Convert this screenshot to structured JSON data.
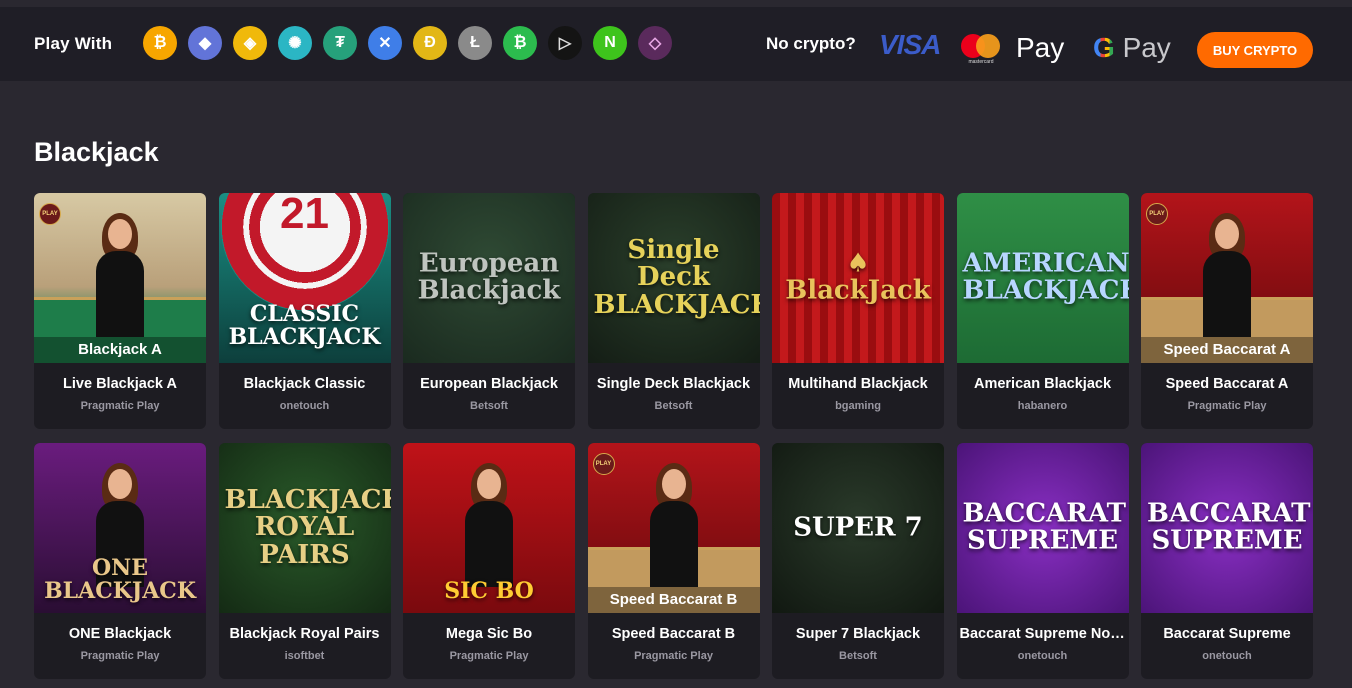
{
  "topbar": {
    "play_with_label": "Play With",
    "coins": [
      {
        "name": "bitcoin-icon",
        "glyph": "₿",
        "color": "#f7a600",
        "fg": "#ffffff"
      },
      {
        "name": "ethereum-icon",
        "glyph": "◆",
        "color": "#6274d8",
        "fg": "#ffffff"
      },
      {
        "name": "binance-icon",
        "glyph": "◈",
        "color": "#f0b90b",
        "fg": "#ffffff"
      },
      {
        "name": "cardano-icon",
        "glyph": "✺",
        "color": "#2bb6c4",
        "fg": "#ffffff"
      },
      {
        "name": "tether-icon",
        "glyph": "₮",
        "color": "#26a17b",
        "fg": "#ffffff"
      },
      {
        "name": "ripple-icon",
        "glyph": "✕",
        "color": "#3f7ee8",
        "fg": "#ffffff"
      },
      {
        "name": "dogecoin-icon",
        "glyph": "Ð",
        "color": "#e2b716",
        "fg": "#ffffff"
      },
      {
        "name": "litecoin-icon",
        "glyph": "Ł",
        "color": "#8a8a8a",
        "fg": "#ffffff"
      },
      {
        "name": "bitcoin-cash-icon",
        "glyph": "₿",
        "color": "#2cbc4e",
        "fg": "#ffffff"
      },
      {
        "name": "tron-icon",
        "glyph": "▷",
        "color": "#141414",
        "fg": "#dddddd"
      },
      {
        "name": "neo-icon",
        "glyph": "N",
        "color": "#3ec41c",
        "fg": "#ffffff"
      },
      {
        "name": "ethereum-classic-icon",
        "glyph": "◇",
        "color": "#5a2a5c",
        "fg": "#e8a7e6"
      }
    ],
    "no_crypto_label": "No crypto?",
    "visa_label": "VISA",
    "mastercard_label": "mastercard",
    "apple_pay_label": "Pay",
    "google_pay_label": "Pay",
    "buy_crypto_label": "BUY CRYPTO"
  },
  "section_title": "Blackjack",
  "games": [
    {
      "name": "Live Blackjack A",
      "provider": "Pragmatic Play",
      "art": {
        "bg": "linear-gradient(180deg,#d7c9a4 0%,#b9a07a 55%,#1e7d4a 80%)",
        "caption": "Blackjack A",
        "live": true,
        "play_badge": "PLAY"
      }
    },
    {
      "name": "Blackjack Classic",
      "provider": "onetouch",
      "art": {
        "bg": "linear-gradient(180deg,#1a8f84 0%,#0d3f3c 100%)",
        "chip": "21",
        "logo": "CLASSIC BLACKJACK",
        "logo_color": "#ffffff"
      }
    },
    {
      "name": "European Blackjack",
      "provider": "Betsoft",
      "art": {
        "bg": "radial-gradient(circle at 50% 40%,#2f4a34 0%,#1a2a1f 100%)",
        "logo": "European Blackjack",
        "logo_color": "#bfc4bf"
      }
    },
    {
      "name": "Single Deck Blackjack",
      "provider": "Betsoft",
      "art": {
        "bg": "radial-gradient(circle at 50% 40%,#2a3f2b 0%,#141d15 100%)",
        "logo": "Single Deck BLACKJACK",
        "logo_color": "#e6d25a"
      }
    },
    {
      "name": "Multihand Blackjack",
      "provider": "bgaming",
      "art": {
        "bg": "repeating-linear-gradient(90deg,#9a0d10 0 8px,#c3191c 8px 16px)",
        "logo": "♠ BlackJack",
        "logo_color": "#e9c35c"
      }
    },
    {
      "name": "American Blackjack",
      "provider": "habanero",
      "art": {
        "bg": "linear-gradient(180deg,#2f8f46 0%,#1d6b34 100%)",
        "logo": "AMERICAN BLACKJACK",
        "logo_color": "#b8d6ff"
      }
    },
    {
      "name": "Speed Baccarat A",
      "provider": "Pragmatic Play",
      "art": {
        "bg": "linear-gradient(180deg,#b3141a 0%,#7c0c10 70%,#c29a5e 82%)",
        "caption": "Speed Baccarat A",
        "live": true,
        "play_badge": "PLAY"
      }
    },
    {
      "name": "ONE Blackjack",
      "provider": "Pragmatic Play",
      "art": {
        "bg": "linear-gradient(180deg,#6a1c7e 0%,#2a0e33 100%)",
        "logo": "ONE BLACKJACK",
        "logo_color": "#e9c78a",
        "live": true
      }
    },
    {
      "name": "Blackjack Royal Pairs",
      "provider": "isoftbet",
      "art": {
        "bg": "radial-gradient(circle at 50% 45%,#2a5b2a 0%,#142a14 100%)",
        "logo": "BLACKJACK ROYAL PAIRS",
        "logo_color": "#e7cf85"
      }
    },
    {
      "name": "Mega Sic Bo",
      "provider": "Pragmatic Play",
      "art": {
        "bg": "linear-gradient(180deg,#c01218 0%,#7a0a0e 100%)",
        "logo": "SIC BO",
        "logo_color": "#ffcc33",
        "live": true
      }
    },
    {
      "name": "Speed Baccarat B",
      "provider": "Pragmatic Play",
      "art": {
        "bg": "linear-gradient(180deg,#b3141a 0%,#7c0c10 70%,#c29a5e 82%)",
        "caption": "Speed Baccarat B",
        "live": true,
        "play_badge": "PLAY"
      }
    },
    {
      "name": "Super 7 Blackjack",
      "provider": "Betsoft",
      "art": {
        "bg": "radial-gradient(circle at 50% 45%,#2a3a2a 0%,#111811 100%)",
        "logo": "SUPER 7",
        "logo_color": "#ffffff"
      }
    },
    {
      "name": "Baccarat Supreme No C...",
      "provider": "onetouch",
      "art": {
        "bg": "radial-gradient(circle at 50% 50%,#8a2fc4 0%,#4b1478 100%)",
        "logo": "BACCARAT SUPREME",
        "logo_color": "#ffffff"
      }
    },
    {
      "name": "Baccarat Supreme",
      "provider": "onetouch",
      "art": {
        "bg": "radial-gradient(circle at 50% 50%,#8a2fc4 0%,#4b1478 100%)",
        "logo": "BACCARAT SUPREME",
        "logo_color": "#ffffff"
      }
    }
  ]
}
